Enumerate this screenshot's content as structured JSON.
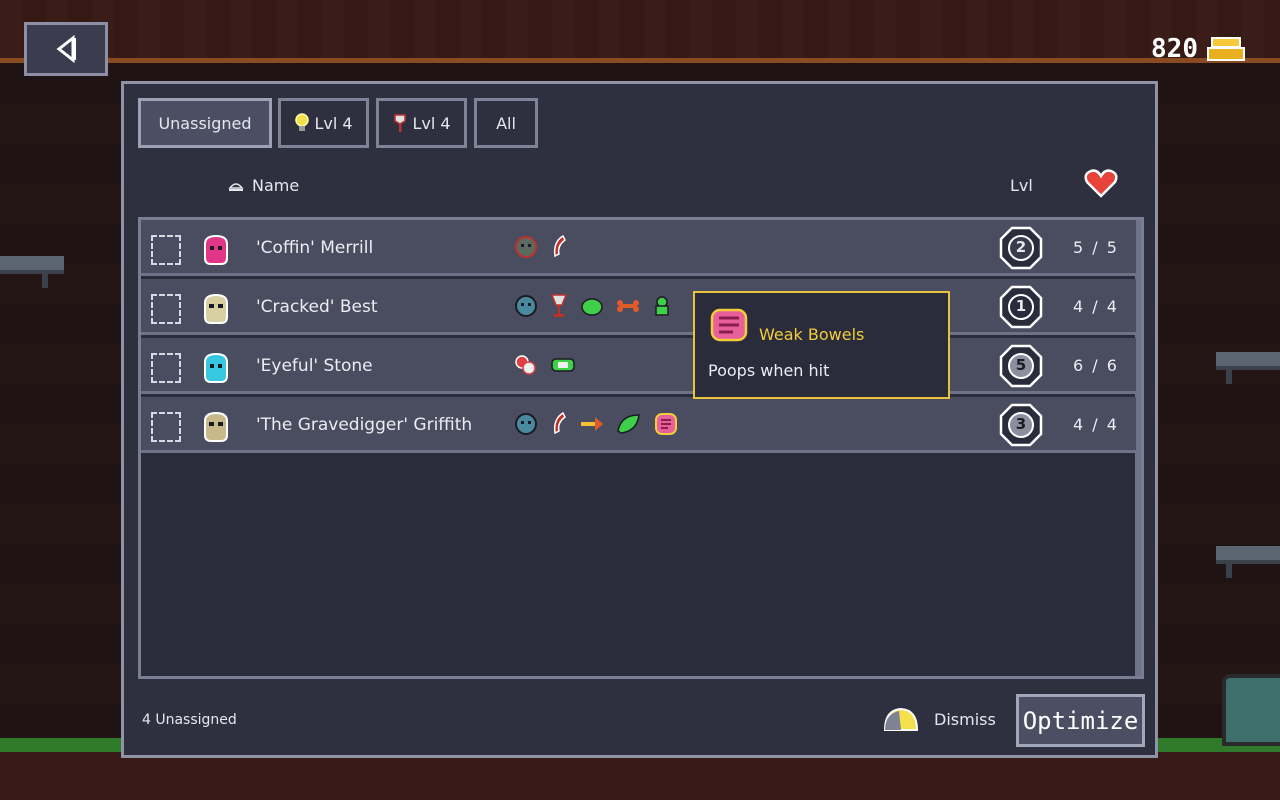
{
  "gold": {
    "value": "820",
    "icon": "gold-bars-icon"
  },
  "back": {
    "icon": "back-arrow-icon"
  },
  "tabs": [
    {
      "label": "Unassigned",
      "icon": ""
    },
    {
      "label": "Lvl 4",
      "icon": "lightbulb-icon"
    },
    {
      "label": "Lvl 4",
      "icon": "shovel-icon"
    },
    {
      "label": "All",
      "icon": ""
    }
  ],
  "header": {
    "name": "Name",
    "lvl": "Lvl",
    "sort_icon": "sort-icon",
    "health_icon": "heart-icon"
  },
  "colors": {
    "gold_text": "#f2cc3a",
    "accent_border": "#e8c23a",
    "heart": "#e8433a"
  },
  "rows": [
    {
      "name": "'Coffin' Merrill",
      "level": "2",
      "hp": "5 / 5",
      "avatar_color": "#e0368a",
      "traits": [
        "zombie-icon",
        "quill-icon"
      ]
    },
    {
      "name": "'Cracked' Best",
      "level": "1",
      "hp": "4 / 4",
      "avatar_color": "#d8cfa2",
      "traits": [
        "zombie-icon",
        "goblet-icon",
        "slime-icon",
        "dog-bone-icon",
        "frog-icon"
      ]
    },
    {
      "name": "'Eyeful' Stone",
      "level": "5",
      "hp": "6 / 6",
      "avatar_color": "#36c8e0",
      "traits": [
        "meat-icon",
        "bandage-icon"
      ]
    },
    {
      "name": "'The Gravedigger' Griffith",
      "level": "3",
      "hp": "4 / 4",
      "avatar_color": "#c9b98a",
      "traits": [
        "zombie-icon",
        "quill-icon",
        "arrow-icon",
        "leaf-icon",
        "bowels-icon"
      ]
    }
  ],
  "tooltip": {
    "title": "Weak Bowels",
    "description": "Poops when hit",
    "icon": "bowels-icon"
  },
  "footer": {
    "count": "4 Unassigned",
    "dismiss_label": "Dismiss",
    "dismiss_icon": "dismiss-icon",
    "optimize_label": "Optimize"
  }
}
